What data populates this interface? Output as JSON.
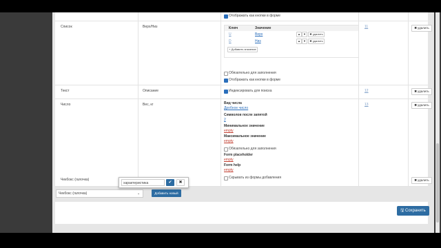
{
  "rows": [
    {
      "name": "Список",
      "desc": "Верх/Низ",
      "index": "11",
      "delete": "удалить"
    },
    {
      "name": "Текст",
      "desc": "Описание",
      "index": "12",
      "delete": "удалить"
    },
    {
      "name": "Число",
      "desc": "Вес, кг",
      "index": "13",
      "delete": "удалить"
    },
    {
      "name": "Чекбокс (галочка)",
      "desc": "empty",
      "delete": "удалить"
    }
  ],
  "top_partial_checkbox": "Отображать как кнопки в форме",
  "list_options": {
    "header_key": "Ключ",
    "header_value": "Значение",
    "items": [
      {
        "key": "U",
        "value": "Верх",
        "delete": "удалить"
      },
      {
        "key": "D",
        "value": "Низ",
        "delete": "удалить"
      }
    ],
    "add_label": "+ Добавить значение"
  },
  "list_checks": [
    {
      "label": "Обязательно для заполнения",
      "checked": false
    },
    {
      "label": "Отображать как кнопки в форме",
      "checked": true
    }
  ],
  "text_check": {
    "label": "Индексировать для поиска",
    "checked": true
  },
  "number_settings": {
    "type_label": "Вид числа",
    "type_value": "Дробное число",
    "decimals_label": "Символов после запятой",
    "decimals_value": "2",
    "min_label": "Минимальное значение",
    "min_value": "empty",
    "max_label": "Максимальное значение",
    "max_value": "empty",
    "required_label": "Обязательно для заполнения",
    "placeholder_label": "Form placeholder",
    "placeholder_value": "empty",
    "help_label": "Form help",
    "help_value": "empty",
    "hide_label": "Скрывать из формы добавления"
  },
  "editor": {
    "value": "характеристика",
    "ok_icon": "check-icon",
    "cancel_icon": "close-icon"
  },
  "footer": {
    "select_value": "Чекбокс (галочка)",
    "add_new": "Добавить новый",
    "save": "Сохранить"
  },
  "colors": {
    "primary": "#2d6ca2",
    "link": "#2a6ebb",
    "empty": "#c0392b"
  }
}
